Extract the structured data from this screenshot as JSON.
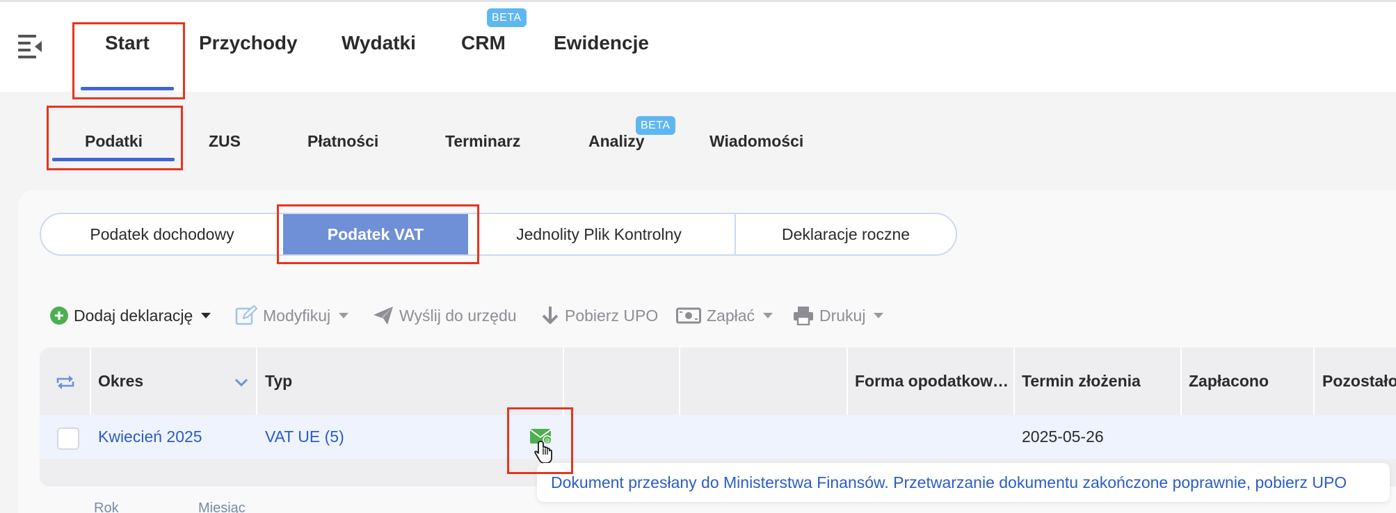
{
  "main_nav": {
    "items": [
      {
        "label": "Start"
      },
      {
        "label": "Przychody"
      },
      {
        "label": "Wydatki"
      },
      {
        "label": "CRM",
        "badge": "BETA"
      },
      {
        "label": "Ewidencje"
      }
    ],
    "active": "Start"
  },
  "sub_nav": {
    "items": [
      {
        "label": "Podatki"
      },
      {
        "label": "ZUS"
      },
      {
        "label": "Płatności"
      },
      {
        "label": "Terminarz"
      },
      {
        "label": "Analizy",
        "badge": "BETA"
      },
      {
        "label": "Wiadomości"
      }
    ],
    "active": "Podatki"
  },
  "segments": {
    "items": [
      {
        "label": "Podatek dochodowy"
      },
      {
        "label": "Podatek VAT"
      },
      {
        "label": "Jednolity Plik Kontrolny"
      },
      {
        "label": "Deklaracje roczne"
      }
    ],
    "active": "Podatek VAT"
  },
  "toolbar": {
    "add": "Dodaj deklarację",
    "modify": "Modyfikuj",
    "send": "Wyślij do urzędu",
    "download_upo": "Pobierz UPO",
    "pay": "Zapłać",
    "print": "Drukuj"
  },
  "table": {
    "columns": [
      "Okres",
      "Typ",
      "",
      "",
      "Forma opodatkow…",
      "Termin złożenia",
      "Zapłacono",
      "Pozostało"
    ],
    "rows": [
      {
        "okres": "Kwiecień 2025",
        "typ": "VAT UE (5)",
        "forma": "",
        "termin": "2025-05-26",
        "zaplacono": "",
        "pozostalo": ""
      }
    ]
  },
  "tooltip": {
    "text": "Dokument przesłany do Ministerstwa Finansów. Przetwarzanie dokumentu zakończone poprawnie, pobierz UPO"
  },
  "filters": {
    "rok": "Rok",
    "miesiac": "Miesiąc"
  },
  "colors": {
    "accent": "#3f66d6",
    "active_segment": "#6f8fd6",
    "beta_badge": "#5fb7f2",
    "link": "#2c5cc5",
    "success_icon": "#4caf50",
    "highlight": "#e8341c"
  },
  "icons": {
    "menu_toggle": "menu-collapse-icon",
    "add": "plus-circle-icon",
    "modify": "edit-icon",
    "send": "paper-plane-icon",
    "download": "arrow-down-icon",
    "pay": "banknote-icon",
    "print": "printer-icon",
    "refresh": "repeat-icon",
    "sort": "chevron-down-icon",
    "status": "envelope-success-icon",
    "cursor": "hand-pointer-icon"
  }
}
